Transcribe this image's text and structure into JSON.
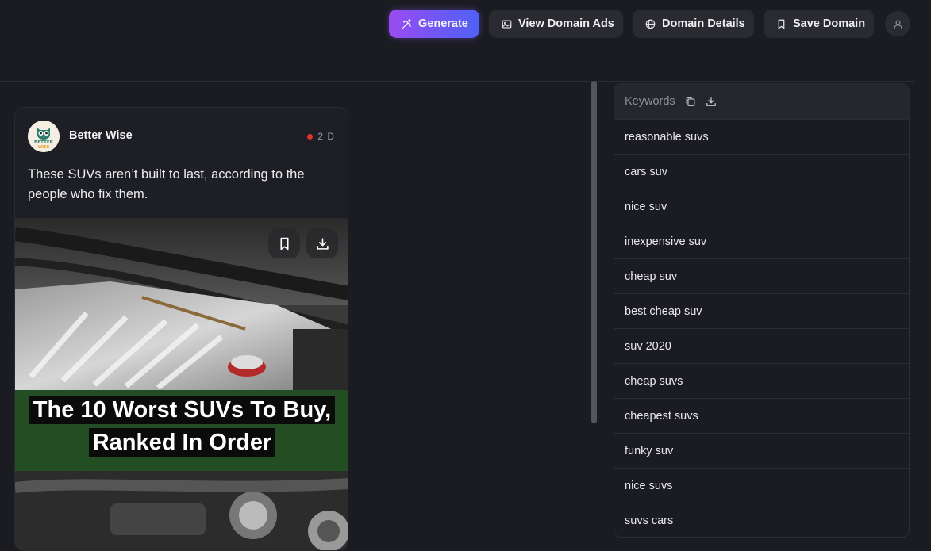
{
  "toolbar": {
    "generate_label": "Generate",
    "view_ads_label": "View Domain Ads",
    "domain_details_label": "Domain Details",
    "save_domain_label": "Save Domain",
    "accent_gradient": [
      "#9a4cf0",
      "#4f62f5"
    ]
  },
  "ad_card": {
    "brand_name": "Better Wise",
    "logo_text_top": "BETTER",
    "logo_text_bottom": "WISE",
    "age": "2 D",
    "headline": "These SUVs aren’t built to last, according to the people who fix them.",
    "image_caption_line1": "The 10 Worst SUVs To Buy,",
    "image_caption_line2": "Ranked In Order"
  },
  "keywords": {
    "title": "Keywords",
    "items": [
      "reasonable suvs",
      "cars suv",
      "nice suv",
      "inexpensive suv",
      "cheap suv",
      "best cheap suv",
      "suv 2020",
      "cheap suvs",
      "cheapest suvs",
      "funky suv",
      "nice suvs",
      "suvs cars"
    ]
  },
  "icons": {
    "generate": "magic-wand-icon",
    "view_ads": "image-icon",
    "domain_details": "globe-icon",
    "save_domain": "bookmark-icon",
    "avatar": "user-icon",
    "copy": "copy-icon",
    "download": "download-icon"
  }
}
